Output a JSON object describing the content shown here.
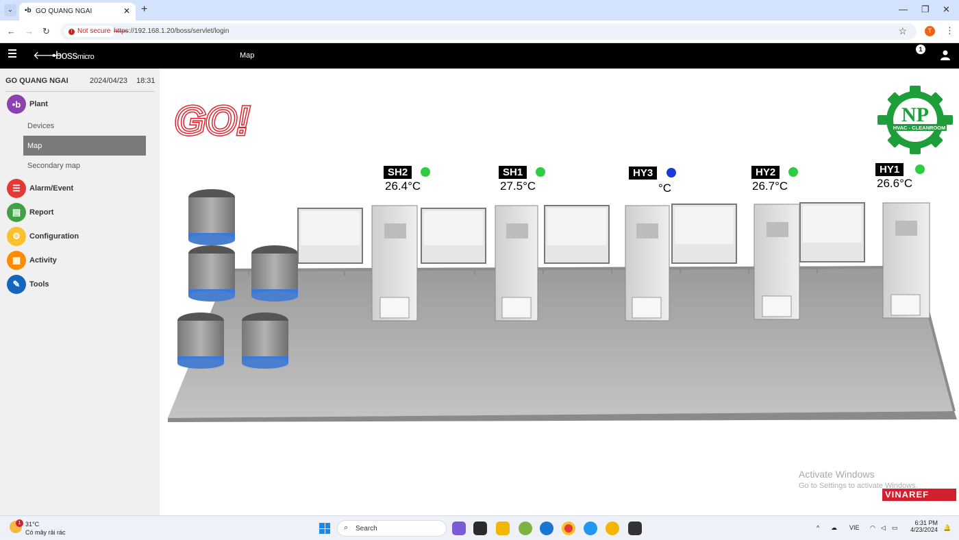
{
  "browser": {
    "tab_title": "GO QUANG NGAI",
    "tab_favicon": "•b",
    "new_tab": "+",
    "security_label": "Not secure",
    "url_scheme": "https",
    "url_rest": "://192.168.1.20/boss/servlet/login",
    "profile_initial": "T"
  },
  "header": {
    "logo_main": "boss",
    "logo_sub": "micro",
    "title": "Map",
    "notifications": "1"
  },
  "sidebar": {
    "site": "GO QUANG NGAI",
    "date": "2024/04/23",
    "time": "18:31",
    "menu": [
      {
        "label": "Plant",
        "icon": "plant-icon",
        "color": "#8e3fb0"
      },
      {
        "label": "Alarm/Event",
        "icon": "alarm-icon",
        "color": "#e53935"
      },
      {
        "label": "Report",
        "icon": "report-icon",
        "color": "#43a047"
      },
      {
        "label": "Configuration",
        "icon": "configuration-icon",
        "color": "#fbc02d"
      },
      {
        "label": "Activity",
        "icon": "activity-icon",
        "color": "#fb8c00"
      },
      {
        "label": "Tools",
        "icon": "tools-icon",
        "color": "#1565c0"
      }
    ],
    "plant_sub": [
      "Devices",
      "Map",
      "Secondary map"
    ],
    "active_sub": "Map"
  },
  "map": {
    "brand_text": "GO!",
    "np_logo_letters": "NP",
    "np_logo_sub": "HVAC - CLEANROOM",
    "units": [
      {
        "name": "SH2",
        "temp": "26.4°C",
        "status_color": "#2ecc40"
      },
      {
        "name": "SH1",
        "temp": "27.5°C",
        "status_color": "#2ecc40"
      },
      {
        "name": "HY3",
        "temp": "°C",
        "status_color": "#1a3bd9"
      },
      {
        "name": "HY2",
        "temp": "26.7°C",
        "status_color": "#2ecc40"
      },
      {
        "name": "HY1",
        "temp": "26.6°C",
        "status_color": "#2ecc40"
      }
    ],
    "watermark_line1": "Activate Windows",
    "watermark_line2": "Go to Settings to activate Windows.",
    "vinaref": "VINAREF"
  },
  "taskbar": {
    "weather_temp": "31°C",
    "weather_desc": "Có mây rải rác",
    "weather_alert": "1",
    "search_placeholder": "Search",
    "lang": "VIE",
    "time": "6:31 PM",
    "date": "4/23/2024"
  }
}
